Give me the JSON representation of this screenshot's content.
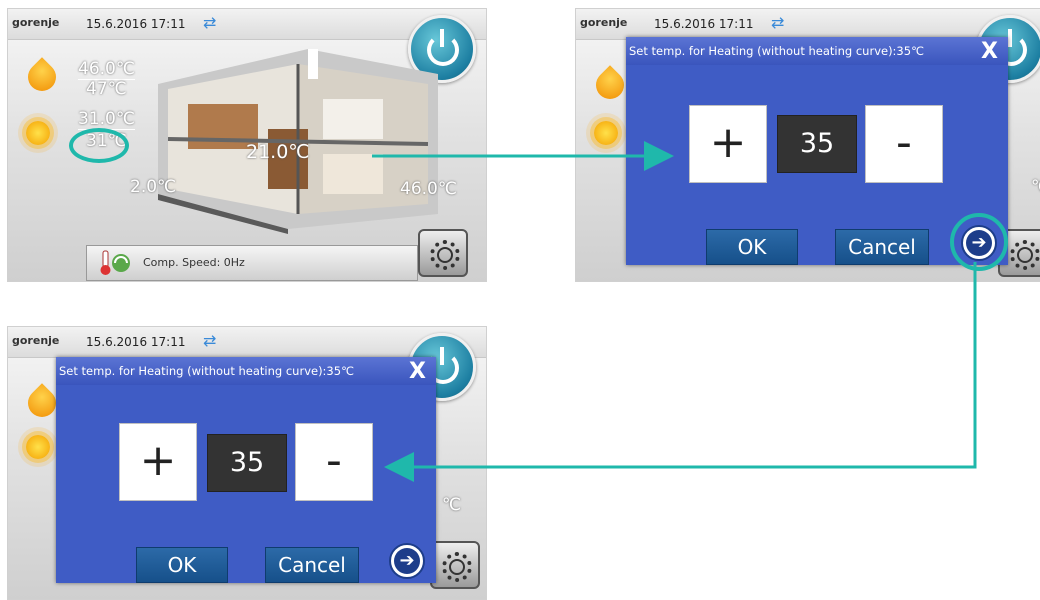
{
  "header": {
    "brand": "gorenje",
    "datetime": "15.6.2016 17:11"
  },
  "home": {
    "dhw_set": "46.0℃",
    "dhw_actual": "47℃",
    "heating_set": "31.0℃",
    "heating_actual": "31℃",
    "indoor": "21.0℃",
    "outdoor": "2.0℃",
    "tank": "46.0℃",
    "comp_speed": "Comp. Speed: 0Hz"
  },
  "dialog": {
    "title": "Set temp. for Heating (without heating curve):35℃",
    "close": "X",
    "plus": "+",
    "minus": "-",
    "value": "35",
    "ok": "OK",
    "cancel": "Cancel"
  },
  "partial_label": "℃",
  "colors": {
    "accent": "#1fb8ab",
    "dialog_bg": "#3f5cc5",
    "button": "#1e5c98"
  },
  "icons": [
    "sync-icon",
    "power-icon",
    "water-drop-icon",
    "sun-icon",
    "thermometer-icon",
    "settings-gear-icon",
    "next-arrow-icon"
  ]
}
